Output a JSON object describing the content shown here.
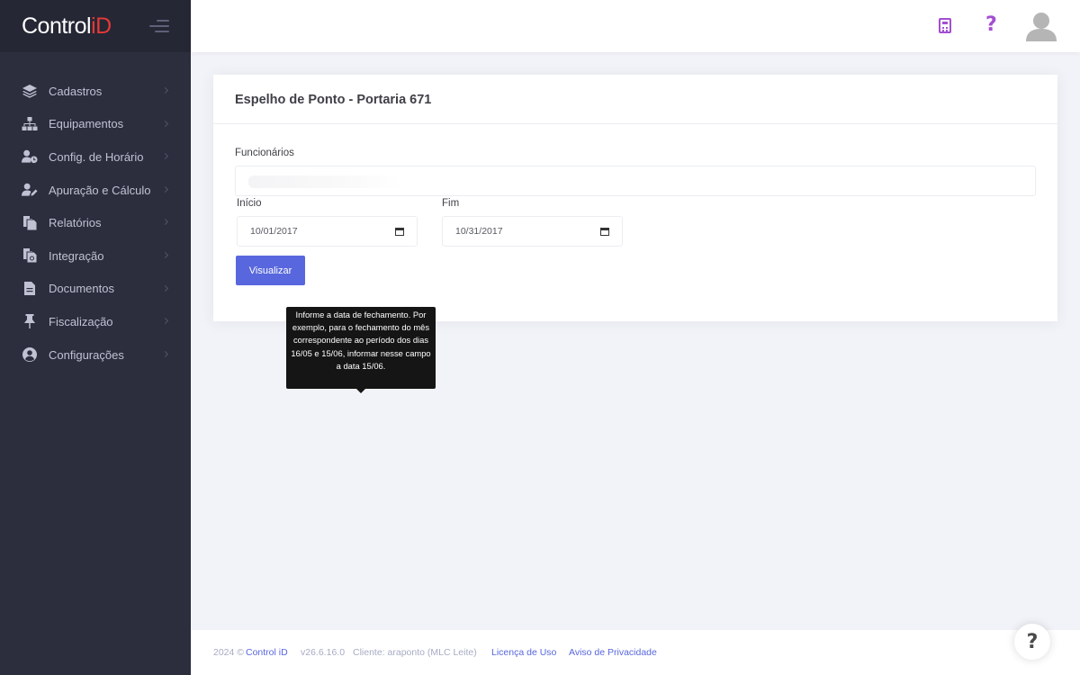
{
  "brand": {
    "name": "Control",
    "suffix": "iD"
  },
  "sidebar": {
    "items": [
      {
        "label": "Cadastros",
        "icon": "layers-icon"
      },
      {
        "label": "Equipamentos",
        "icon": "sitemap-icon"
      },
      {
        "label": "Config. de Horário",
        "icon": "user-clock-icon"
      },
      {
        "label": "Apuração e Cálculo",
        "icon": "user-edit-icon"
      },
      {
        "label": "Relatórios",
        "icon": "documents-icon"
      },
      {
        "label": "Integração",
        "icon": "documents-sync-icon"
      },
      {
        "label": "Documentos",
        "icon": "file-icon"
      },
      {
        "label": "Fiscalização",
        "icon": "thumbtack-icon"
      },
      {
        "label": "Configurações",
        "icon": "user-circle-icon"
      }
    ]
  },
  "topbar": {
    "calculator_icon": "calculator-icon",
    "help_icon": "question-icon",
    "avatar_icon": "user-avatar-icon",
    "accent_color": "#a34fd1"
  },
  "card": {
    "title": "Espelho de Ponto - Portaria 671",
    "employees_label": "Funcionários",
    "start_label": "Início",
    "start_value": "10/01/2017",
    "end_label": "Fim",
    "end_value": "10/31/2017",
    "submit_label": "Visualizar",
    "button_color": "#5867dd"
  },
  "tooltip": {
    "text": "Informe a data de fechamento. Por exemplo, para o fechamento do mês correspondente ao período dos dias 16/05 e 15/06, informar nesse campo a data 15/06."
  },
  "footer": {
    "copyright": "2024 ©",
    "brand_link": "Control iD",
    "version": "v26.6.16.0",
    "client": "Cliente: araponto (MLC Leite)",
    "license_link": "Licença de Uso",
    "privacy_link": "Aviso de Privacidade",
    "help_button": "?"
  }
}
